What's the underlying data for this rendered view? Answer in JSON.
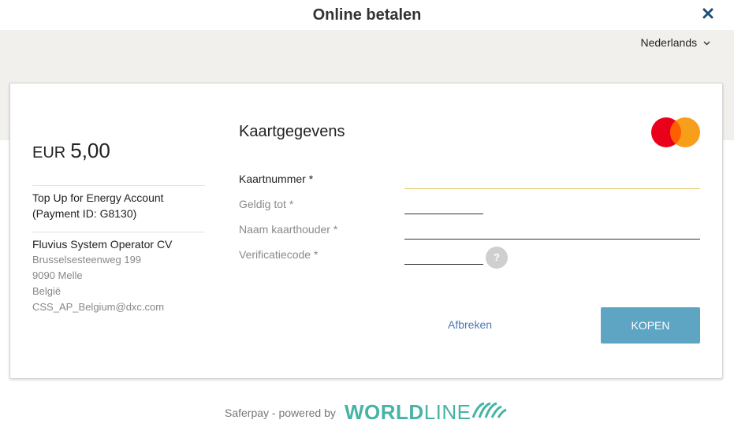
{
  "header": {
    "title": "Online betalen",
    "close_icon": "close-icon"
  },
  "language": {
    "selected": "Nederlands",
    "icon": "chevron-down-icon"
  },
  "order": {
    "currency": "EUR",
    "amount": "5,00",
    "description_line1": "Top Up for Energy Account",
    "description_line2": "(Payment ID: G8130)"
  },
  "merchant": {
    "name": "Fluvius System Operator CV",
    "street": "Brusselsesteenweg 199",
    "city": "9090 Melle",
    "country": "België",
    "email": "CSS_AP_Belgium@dxc.com"
  },
  "form": {
    "title": "Kaartgegevens",
    "card_brand": "mastercard-icon",
    "fields": {
      "card_number": {
        "label": "Kaartnummer *",
        "value": ""
      },
      "expiry": {
        "label": "Geldig tot *",
        "value": ""
      },
      "holder": {
        "label": "Naam kaarthouder *",
        "value": ""
      },
      "cvc": {
        "label": "Verificatiecode *",
        "value": ""
      }
    },
    "help_label": "?",
    "cancel_label": "Afbreken",
    "buy_label": "KOPEN"
  },
  "footer": {
    "powered_by": "Saferpay - powered by",
    "brand_part1": "WORLD",
    "brand_part2": "LINE"
  },
  "colors": {
    "accent_button": "#5ea5c4",
    "link": "#4a78b0",
    "focus_underline": "#e7c86a",
    "brand": "#46b4a5",
    "mastercard_red": "#eb001b",
    "mastercard_orange": "#f79e1b"
  }
}
